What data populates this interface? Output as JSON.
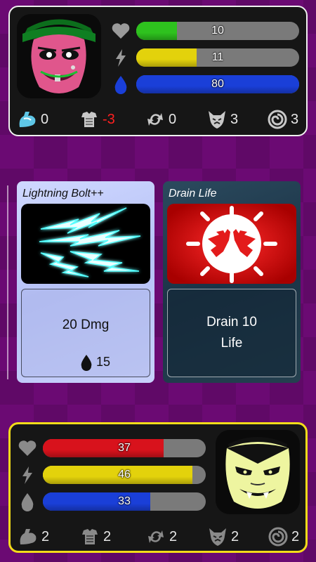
{
  "enemy": {
    "portrait_icon": "witch-face-icon",
    "stats": [
      {
        "name": "life",
        "icon": "heart-icon",
        "value": "10",
        "fill": 0.25,
        "color": "#2ec21e"
      },
      {
        "name": "energy",
        "icon": "lightning-icon",
        "value": "11",
        "fill": 0.37,
        "color": "#e3d20c"
      },
      {
        "name": "mana",
        "icon": "drop-icon",
        "value": "80",
        "fill": 1.0,
        "color": "#1a3fd8"
      }
    ],
    "buffs": [
      {
        "icon": "flex-arm-icon",
        "value": "0"
      },
      {
        "icon": "armor-icon",
        "value": "-3"
      },
      {
        "icon": "cycle-arrows-icon",
        "value": "0"
      },
      {
        "icon": "demon-mask-icon",
        "value": "3"
      },
      {
        "icon": "spiral-icon",
        "value": "3"
      }
    ]
  },
  "cards": [
    {
      "title": "Lightning Bolt++",
      "art_icon": "lightning-bolts-icon",
      "description": "20 Dmg",
      "cost": "15",
      "cost_icon": "drop-icon"
    },
    {
      "title": "Drain Life",
      "art_icon": "drain-hands-icon",
      "description_line1": "Drain 10",
      "description_line2": "Life"
    }
  ],
  "player": {
    "portrait_icon": "vampire-face-icon",
    "stats": [
      {
        "name": "life",
        "icon": "heart-icon",
        "value": "37",
        "fill": 0.74,
        "color": "#d8121c"
      },
      {
        "name": "energy",
        "icon": "lightning-icon",
        "value": "46",
        "fill": 0.92,
        "color": "#e3d20c"
      },
      {
        "name": "mana",
        "icon": "drop-icon",
        "value": "33",
        "fill": 0.66,
        "color": "#1a3fd8"
      }
    ],
    "buffs": [
      {
        "icon": "flex-arm-icon",
        "value": "2"
      },
      {
        "icon": "armor-icon",
        "value": "2"
      },
      {
        "icon": "cycle-arrows-icon",
        "value": "2"
      },
      {
        "icon": "demon-mask-icon",
        "value": "2"
      },
      {
        "icon": "spiral-icon",
        "value": "2"
      }
    ]
  }
}
